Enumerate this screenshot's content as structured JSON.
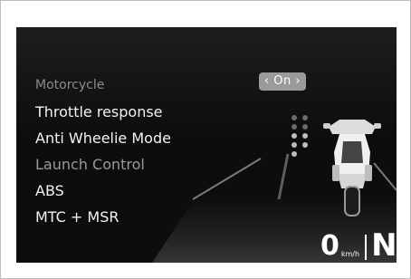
{
  "menu": {
    "header": "Motorcycle",
    "items": [
      {
        "label": "Throttle response"
      },
      {
        "label": "Anti Wheelie Mode"
      },
      {
        "label": "Launch Control"
      },
      {
        "label": "ABS"
      },
      {
        "label": "MTC + MSR"
      }
    ]
  },
  "value": {
    "label": "On",
    "left_arrow": "‹",
    "right_arrow": "›"
  },
  "status": {
    "speed": "0",
    "speed_unit": "km/h",
    "gear": "N"
  },
  "colors": {
    "screen_bg": "#0d0d0d",
    "text": "#f2f2f2",
    "dim_text": "#9a9a9a",
    "pill": "#9a9a9a"
  }
}
